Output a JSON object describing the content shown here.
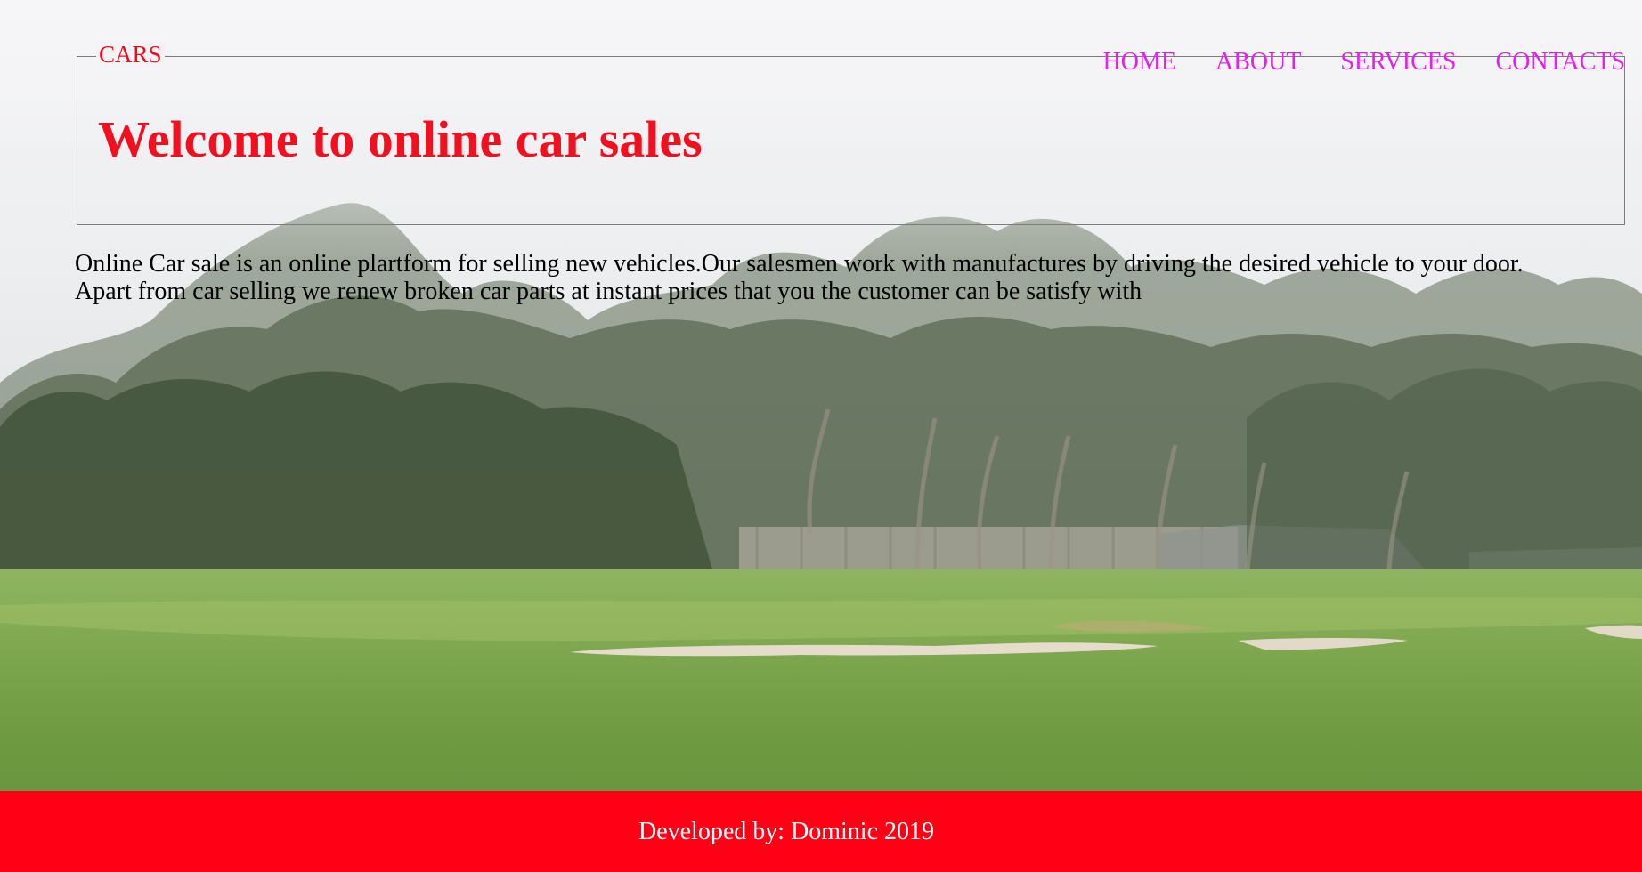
{
  "header": {
    "brand": "CARS",
    "title": "Welcome to online car sales"
  },
  "nav": {
    "items": [
      {
        "label": "HOME"
      },
      {
        "label": "ABOUT"
      },
      {
        "label": "SERVICES"
      },
      {
        "label": "CONTACTS"
      }
    ]
  },
  "main": {
    "intro_line1": "Online Car sale is an online plartform for selling new vehicles.Our salesmen work with manufactures by driving the desired vehicle to your door.",
    "intro_line2": "Apart from car selling we renew broken car parts at instant prices that you the customer can be satisfy with"
  },
  "footer": {
    "credit": "Developed by: Dominic 2019"
  },
  "colors": {
    "brand_red": "#f0101f",
    "nav_magenta": "#e421ec",
    "footer_red": "#ff0015"
  }
}
